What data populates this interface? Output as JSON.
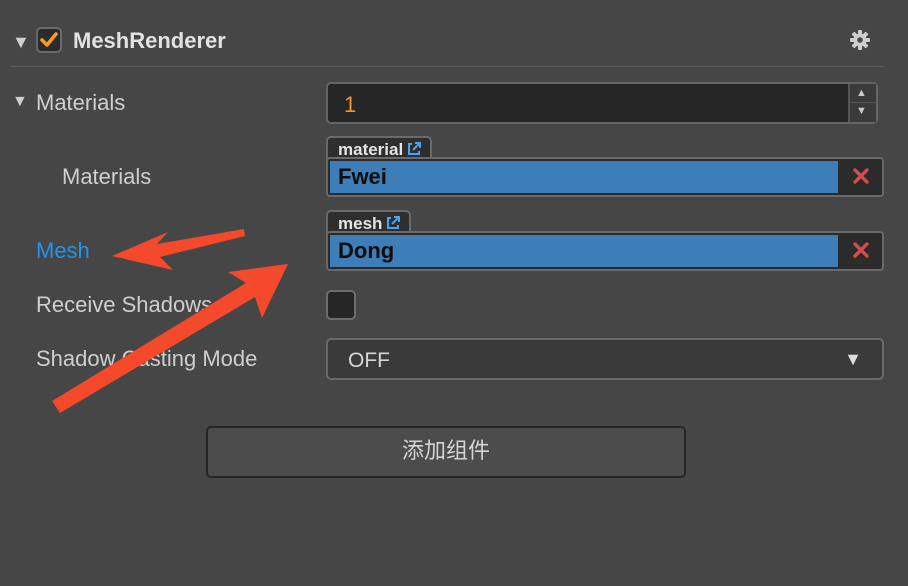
{
  "component": {
    "title": "MeshRenderer",
    "enabled": true
  },
  "materials": {
    "label": "Materials",
    "count": "1",
    "element_label": "Materials",
    "material_tag": "material",
    "material_value": "Fwei"
  },
  "mesh": {
    "label": "Mesh",
    "tag": "mesh",
    "value": "Dong"
  },
  "receive_shadows": {
    "label": "Receive Shadows",
    "checked": false
  },
  "shadow_casting": {
    "label": "Shadow Casting Mode",
    "value": "OFF"
  },
  "add_component_label": "添加组件",
  "colors": {
    "panel_bg": "#464646",
    "accent_blue": "#3d7db8",
    "mesh_label_blue": "#1d95f0",
    "number_orange": "#f4942b",
    "checkbox_orange": "#f39a2d",
    "annotation_arrow": "#f4492b"
  },
  "icons": [
    "collapse-caret-icon",
    "checkmark-icon",
    "gear-icon",
    "external-link-icon",
    "clear-x-icon",
    "dropdown-arrow-icon"
  ]
}
